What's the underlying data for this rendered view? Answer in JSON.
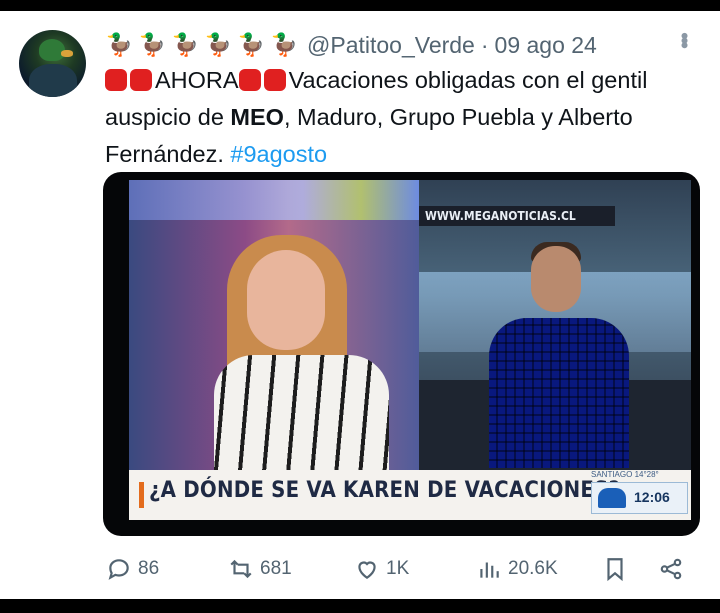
{
  "post": {
    "emoji_prefix": [
      "🦆",
      "🦆",
      "🦆",
      "🦆",
      "🦆",
      "🦆"
    ],
    "handle": "@Patitoo_Verde",
    "separator": "·",
    "date": "09 ago 24",
    "text": {
      "lead": "AHORA",
      "part1": "Vacaciones obligadas con el gentil auspicio de ",
      "bold": "MEO",
      "part2": ", Maduro, Grupo Puebla y Alberto Fernández. ",
      "hashtag": "#9agosto"
    },
    "media": {
      "url_text": "WWW.MEGANOTICIAS.CL",
      "ticker_text": "SANTIAGO 14°28°",
      "headline": "¿A DÓNDE SE VA KAREN DE VACACIONES?",
      "clock": "12:06"
    },
    "actions": {
      "replies": "86",
      "reposts": "681",
      "likes": "1K",
      "views": "20.6K"
    }
  },
  "colors": {
    "text": "#0f1419",
    "muted": "#536471",
    "link": "#1d9bf0",
    "stop_red": "#e02020"
  },
  "icons": [
    "reply-icon",
    "repost-icon",
    "like-icon",
    "views-icon",
    "bookmark-icon",
    "share-icon",
    "more-icon",
    "stop-sign-icon"
  ]
}
